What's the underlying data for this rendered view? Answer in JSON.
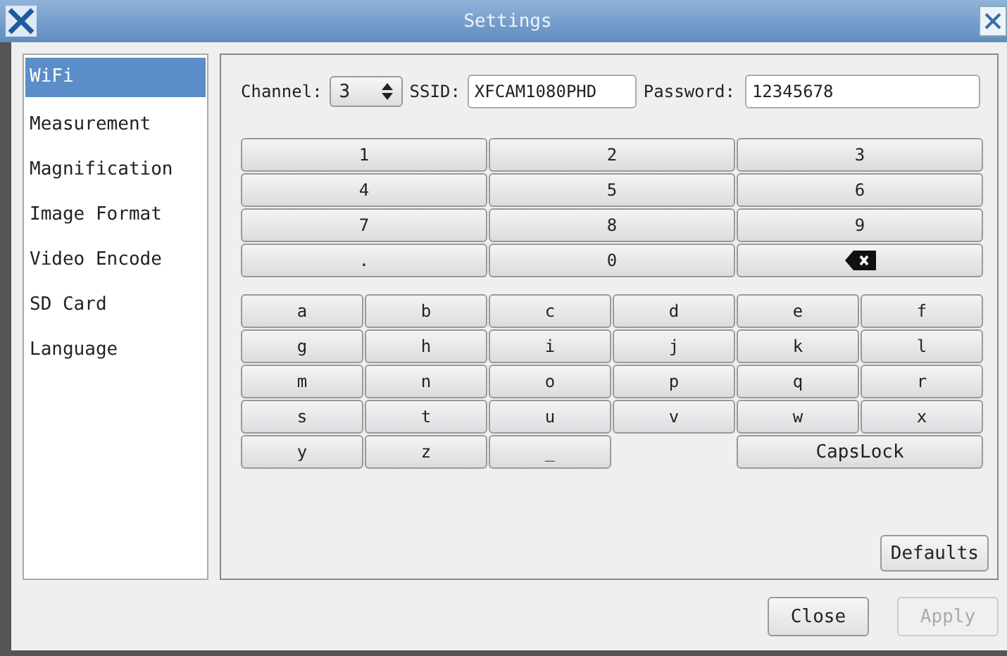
{
  "window": {
    "title": "Settings"
  },
  "sidebar": {
    "items": [
      {
        "label": "WiFi",
        "selected": true
      },
      {
        "label": "Measurement",
        "selected": false
      },
      {
        "label": "Magnification",
        "selected": false
      },
      {
        "label": "Image Format",
        "selected": false
      },
      {
        "label": "Video Encode",
        "selected": false
      },
      {
        "label": "SD Card",
        "selected": false
      },
      {
        "label": "Language",
        "selected": false
      }
    ]
  },
  "wifi": {
    "channel": {
      "label": "Channel:",
      "value": "3"
    },
    "ssid": {
      "label": "SSID:",
      "value": "XFCAM1080PHD"
    },
    "password": {
      "label": "Password:",
      "value": "12345678"
    }
  },
  "numpad": [
    {
      "kind": "char",
      "label": "1"
    },
    {
      "kind": "char",
      "label": "2"
    },
    {
      "kind": "char",
      "label": "3"
    },
    {
      "kind": "char",
      "label": "4"
    },
    {
      "kind": "char",
      "label": "5"
    },
    {
      "kind": "char",
      "label": "6"
    },
    {
      "kind": "char",
      "label": "7"
    },
    {
      "kind": "char",
      "label": "8"
    },
    {
      "kind": "char",
      "label": "9"
    },
    {
      "kind": "char",
      "label": "."
    },
    {
      "kind": "char",
      "label": "0"
    },
    {
      "kind": "backspace"
    }
  ],
  "letters": [
    {
      "kind": "char",
      "label": "a"
    },
    {
      "kind": "char",
      "label": "b"
    },
    {
      "kind": "char",
      "label": "c"
    },
    {
      "kind": "char",
      "label": "d"
    },
    {
      "kind": "char",
      "label": "e"
    },
    {
      "kind": "char",
      "label": "f"
    },
    {
      "kind": "char",
      "label": "g"
    },
    {
      "kind": "char",
      "label": "h"
    },
    {
      "kind": "char",
      "label": "i"
    },
    {
      "kind": "char",
      "label": "j"
    },
    {
      "kind": "char",
      "label": "k"
    },
    {
      "kind": "char",
      "label": "l"
    },
    {
      "kind": "char",
      "label": "m"
    },
    {
      "kind": "char",
      "label": "n"
    },
    {
      "kind": "char",
      "label": "o"
    },
    {
      "kind": "char",
      "label": "p"
    },
    {
      "kind": "char",
      "label": "q"
    },
    {
      "kind": "char",
      "label": "r"
    },
    {
      "kind": "char",
      "label": "s"
    },
    {
      "kind": "char",
      "label": "t"
    },
    {
      "kind": "char",
      "label": "u"
    },
    {
      "kind": "char",
      "label": "v"
    },
    {
      "kind": "char",
      "label": "w"
    },
    {
      "kind": "char",
      "label": "x"
    },
    {
      "kind": "char",
      "label": "y"
    },
    {
      "kind": "char",
      "label": "z"
    },
    {
      "kind": "char",
      "label": "_"
    },
    {
      "kind": "blank"
    },
    {
      "kind": "wide",
      "label": "CapsLock"
    }
  ],
  "defaults_button": {
    "label": "Defaults"
  },
  "buttons": [
    {
      "label": "Close",
      "disabled": false
    },
    {
      "label": "Apply",
      "disabled": true
    }
  ]
}
